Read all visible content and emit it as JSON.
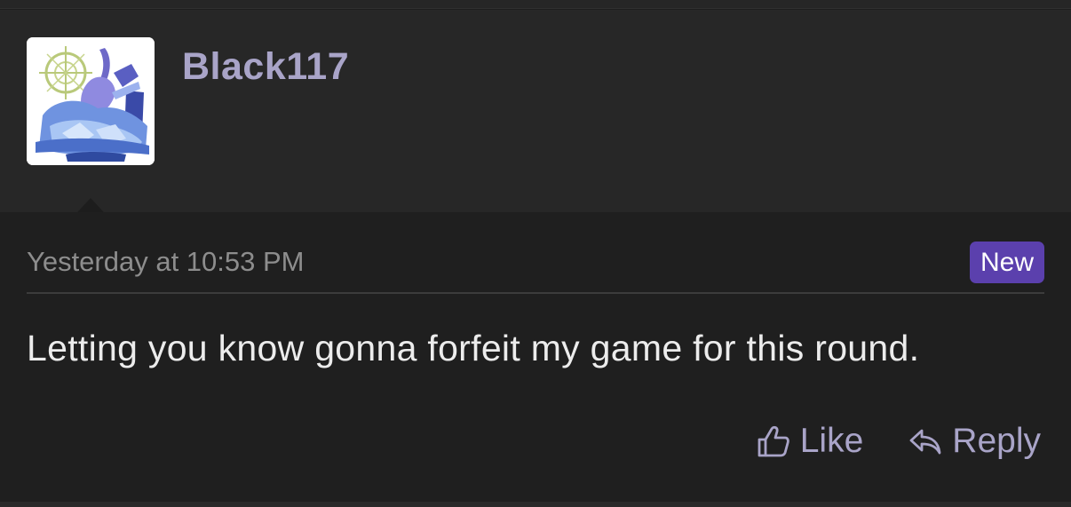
{
  "post": {
    "author": {
      "username": "Black117",
      "avatar_icon": "avatar-image"
    },
    "timestamp": "Yesterday at 10:53 PM",
    "badge": "New",
    "message": "Letting you know gonna forfeit my game for this round.",
    "actions": {
      "like_label": "Like",
      "like_icon": "thumbs-up-icon",
      "reply_label": "Reply",
      "reply_icon": "reply-arrow-icon"
    }
  },
  "colors": {
    "accent": "#a9a4c8",
    "badge_bg": "#5b40ad",
    "header_bg": "#272727",
    "body_bg": "#1f1f1f"
  }
}
